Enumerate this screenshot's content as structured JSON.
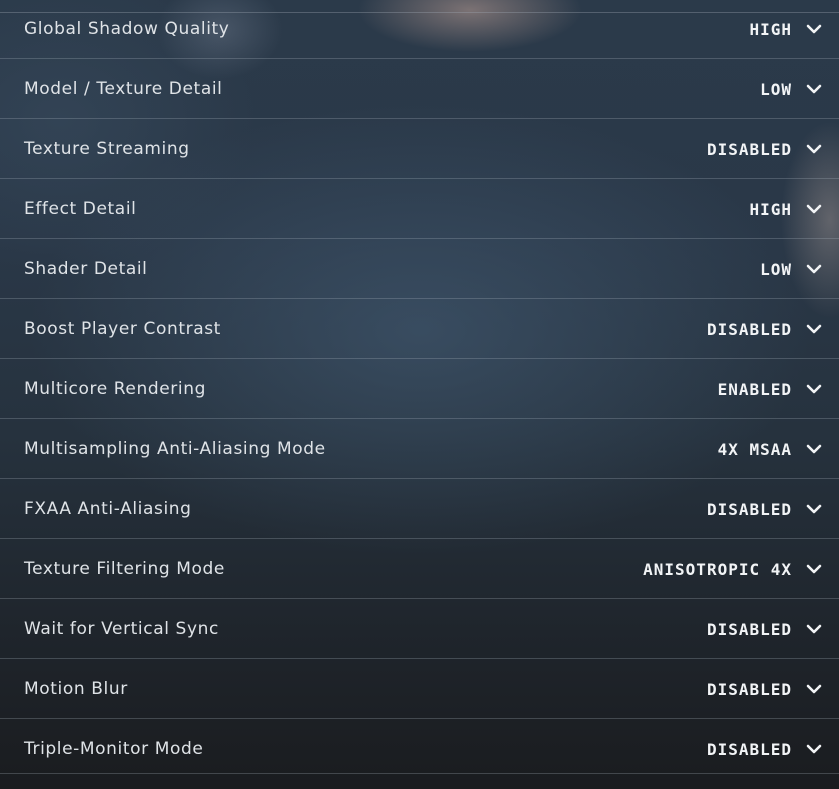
{
  "settings": [
    {
      "label": "Global Shadow Quality",
      "value": "HIGH"
    },
    {
      "label": "Model / Texture Detail",
      "value": "LOW"
    },
    {
      "label": "Texture Streaming",
      "value": "DISABLED"
    },
    {
      "label": "Effect Detail",
      "value": "HIGH"
    },
    {
      "label": "Shader Detail",
      "value": "LOW"
    },
    {
      "label": "Boost Player Contrast",
      "value": "DISABLED"
    },
    {
      "label": "Multicore Rendering",
      "value": "ENABLED"
    },
    {
      "label": "Multisampling Anti-Aliasing Mode",
      "value": "4X MSAA"
    },
    {
      "label": "FXAA Anti-Aliasing",
      "value": "DISABLED"
    },
    {
      "label": "Texture Filtering Mode",
      "value": "ANISOTROPIC 4X"
    },
    {
      "label": "Wait for Vertical Sync",
      "value": "DISABLED"
    },
    {
      "label": "Motion Blur",
      "value": "DISABLED"
    },
    {
      "label": "Triple-Monitor Mode",
      "value": "DISABLED"
    }
  ],
  "icons": {
    "dropdown": "chevron-down-icon"
  }
}
